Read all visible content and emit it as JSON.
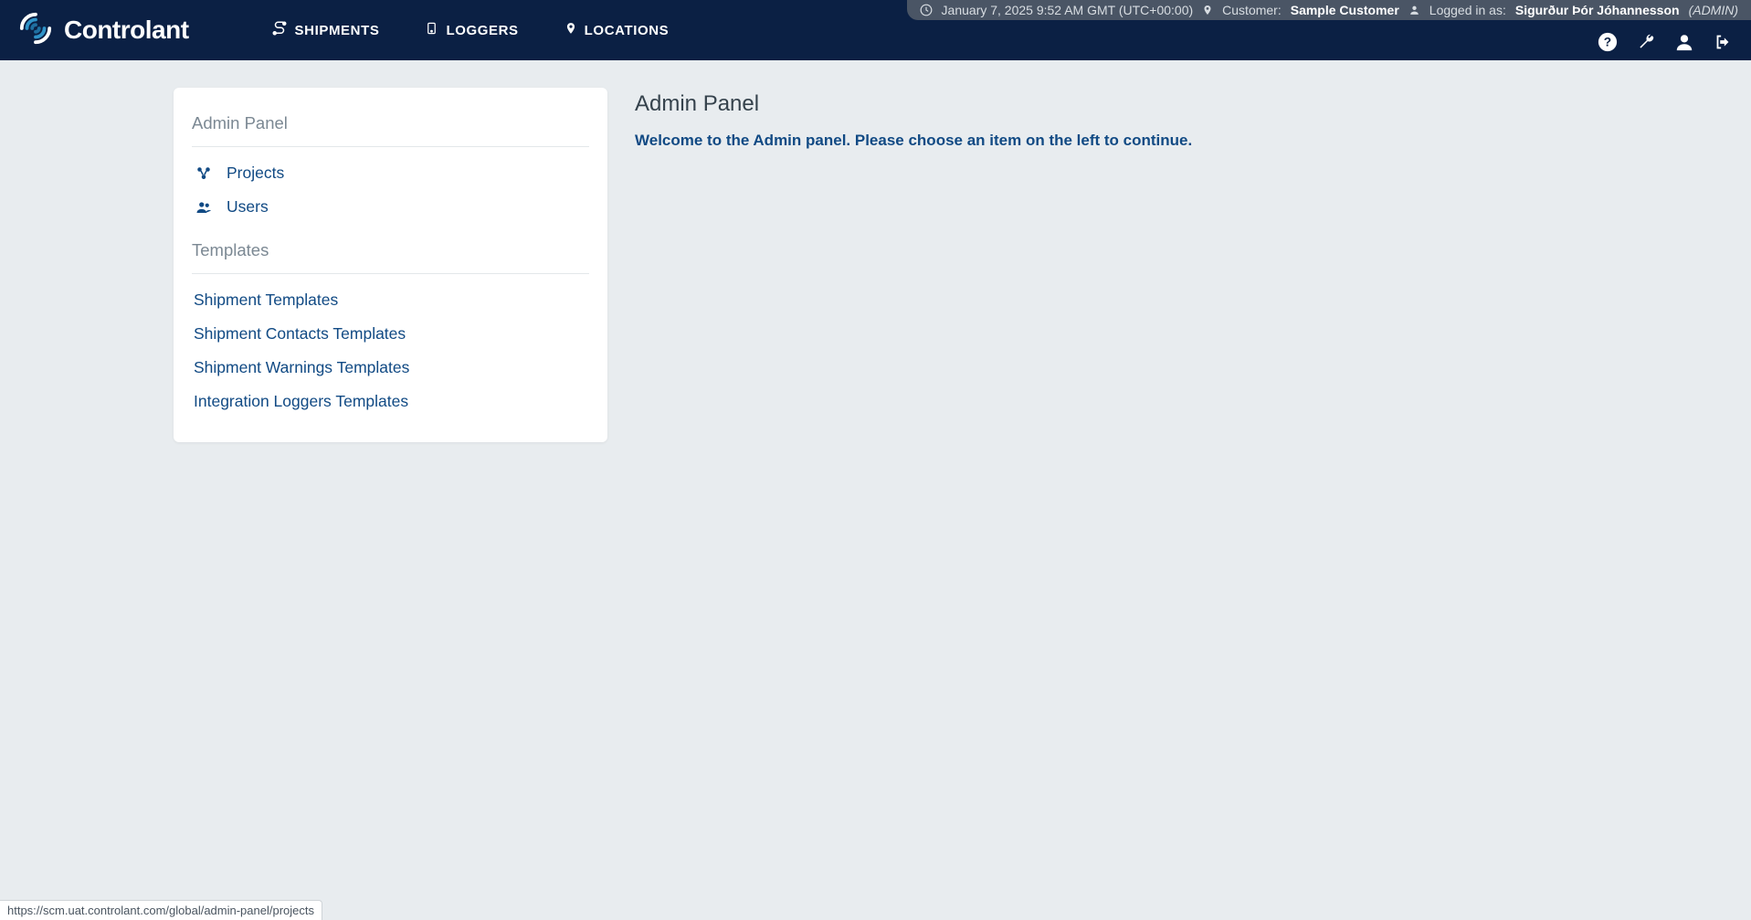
{
  "status": {
    "datetime": "January 7, 2025 9:52 AM GMT (UTC+00:00)",
    "customer_label": "Customer:",
    "customer_name": "Sample Customer",
    "logged_in_label": "Logged in as:",
    "user_name": "Sigurður Þór Jóhannesson",
    "role": "(ADMIN)"
  },
  "brand": "Controlant",
  "nav": {
    "shipments": "SHIPMENTS",
    "loggers": "LOGGERS",
    "locations": "LOCATIONS"
  },
  "sidebar": {
    "section1_title": "Admin Panel",
    "items1": {
      "projects": "Projects",
      "users": "Users"
    },
    "section2_title": "Templates",
    "items2": {
      "shipment_templates": "Shipment Templates",
      "shipment_contacts": "Shipment Contacts Templates",
      "shipment_warnings": "Shipment Warnings Templates",
      "integration_loggers": "Integration Loggers Templates"
    }
  },
  "content": {
    "title": "Admin Panel",
    "welcome": "Welcome to the Admin panel. Please choose an item on the left to continue."
  },
  "link_preview": "https://scm.uat.controlant.com/global/admin-panel/projects"
}
